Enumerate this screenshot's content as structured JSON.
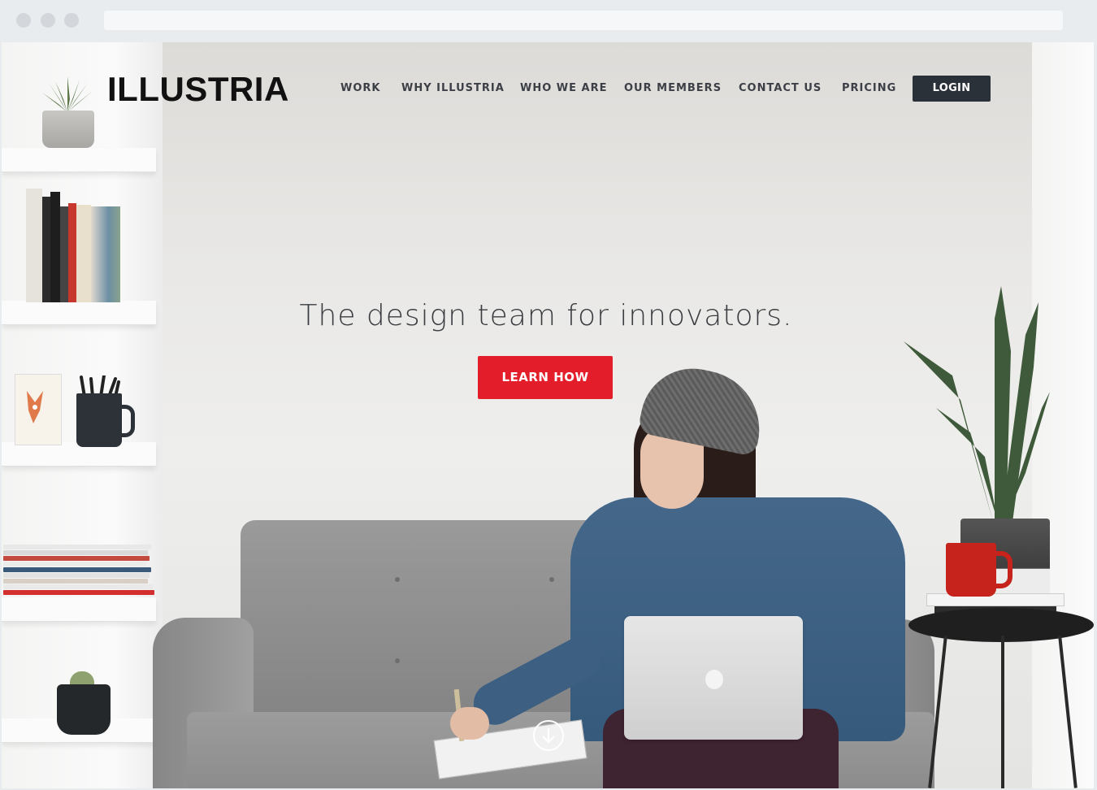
{
  "brand": {
    "name": "ILLUSTRIA"
  },
  "nav": {
    "items": [
      {
        "label": "WORK"
      },
      {
        "label": "WHY ILLUSTRIA"
      },
      {
        "label": "WHO WE ARE"
      },
      {
        "label": "OUR MEMBERS"
      },
      {
        "label": "CONTACT US"
      },
      {
        "label": "PRICING"
      }
    ],
    "login_label": "LOGIN"
  },
  "hero": {
    "headline": "The design team for innovators.",
    "cta_label": "LEARN HOW"
  },
  "colors": {
    "accent": "#e31e2a",
    "dark": "#2b3138",
    "text": "#3a3d40"
  },
  "icons": {
    "scroll": "arrow-down-circle-icon",
    "browser_controls": "window-dots-icon"
  }
}
